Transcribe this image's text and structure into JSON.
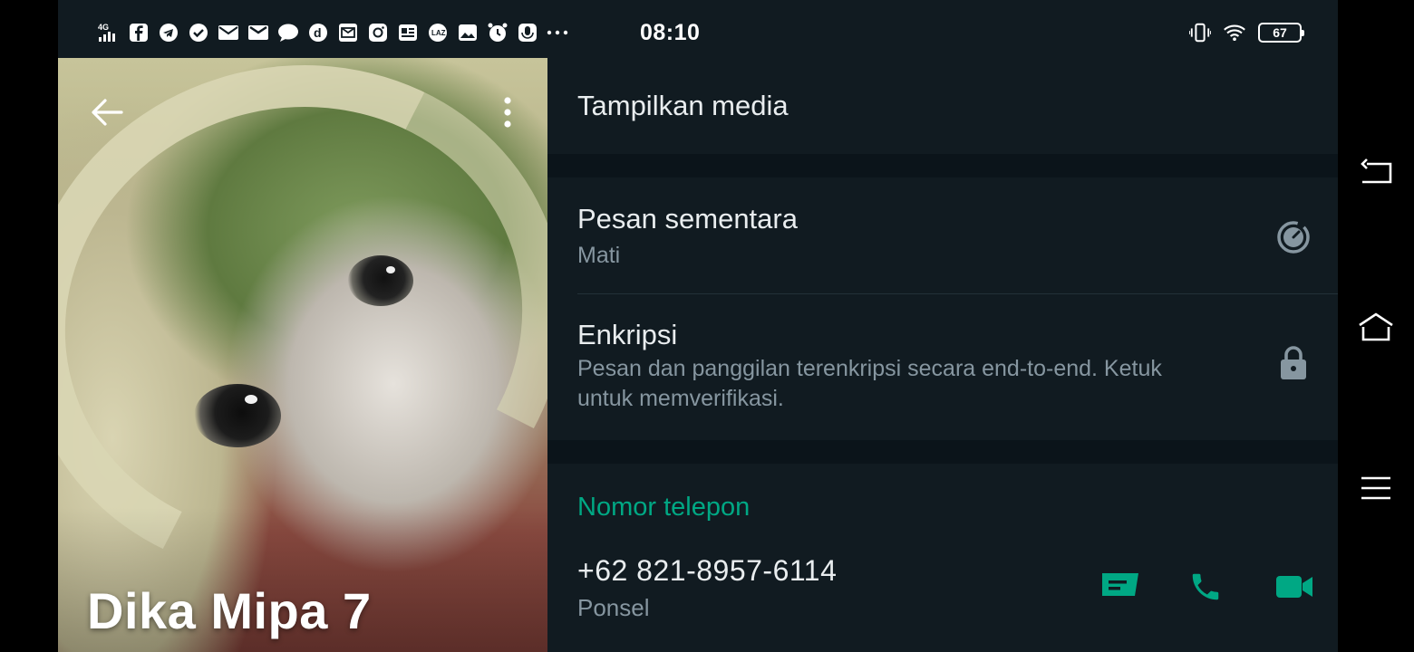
{
  "status_bar": {
    "time": "08:10",
    "network": "4G",
    "battery_level": "67",
    "left_icons": [
      "signal-icon",
      "facebook-icon",
      "telegram-icon",
      "check-circle-icon",
      "mail-icon",
      "gmail-icon",
      "chat-bubble-icon",
      "dana-icon",
      "email-box-icon",
      "instagram-icon",
      "news-icon",
      "lazada-icon",
      "image-icon",
      "alarm-icon",
      "voice-icon",
      "more-dots-icon"
    ],
    "right_icons": [
      "vibrate-icon",
      "wifi-icon",
      "battery-icon"
    ]
  },
  "profile": {
    "name": "Dika Mipa 7",
    "back_icon": "arrow-left-icon",
    "menu_icon": "more-vertical-icon"
  },
  "media": {
    "label": "Tampilkan media"
  },
  "disappearing": {
    "title": "Pesan sementara",
    "value": "Mati",
    "icon": "timer-icon"
  },
  "encryption": {
    "title": "Enkripsi",
    "description_line1": "Pesan dan panggilan terenkripsi secara end-to-end. Ketuk",
    "description_line2": "untuk memverifikasi.",
    "icon": "lock-icon"
  },
  "phone": {
    "section_title": "Nomor telepon",
    "number": "+62 821-8957-6114",
    "type": "Ponsel",
    "actions": [
      "message-icon",
      "call-icon",
      "video-call-icon"
    ]
  },
  "colors": {
    "accent": "#00a884",
    "background": "#0b141a",
    "card": "#111b21",
    "primary_text": "#e9edef",
    "secondary_text": "#8696a0"
  },
  "system_nav": [
    "back-icon",
    "home-icon",
    "recents-menu-icon"
  ]
}
